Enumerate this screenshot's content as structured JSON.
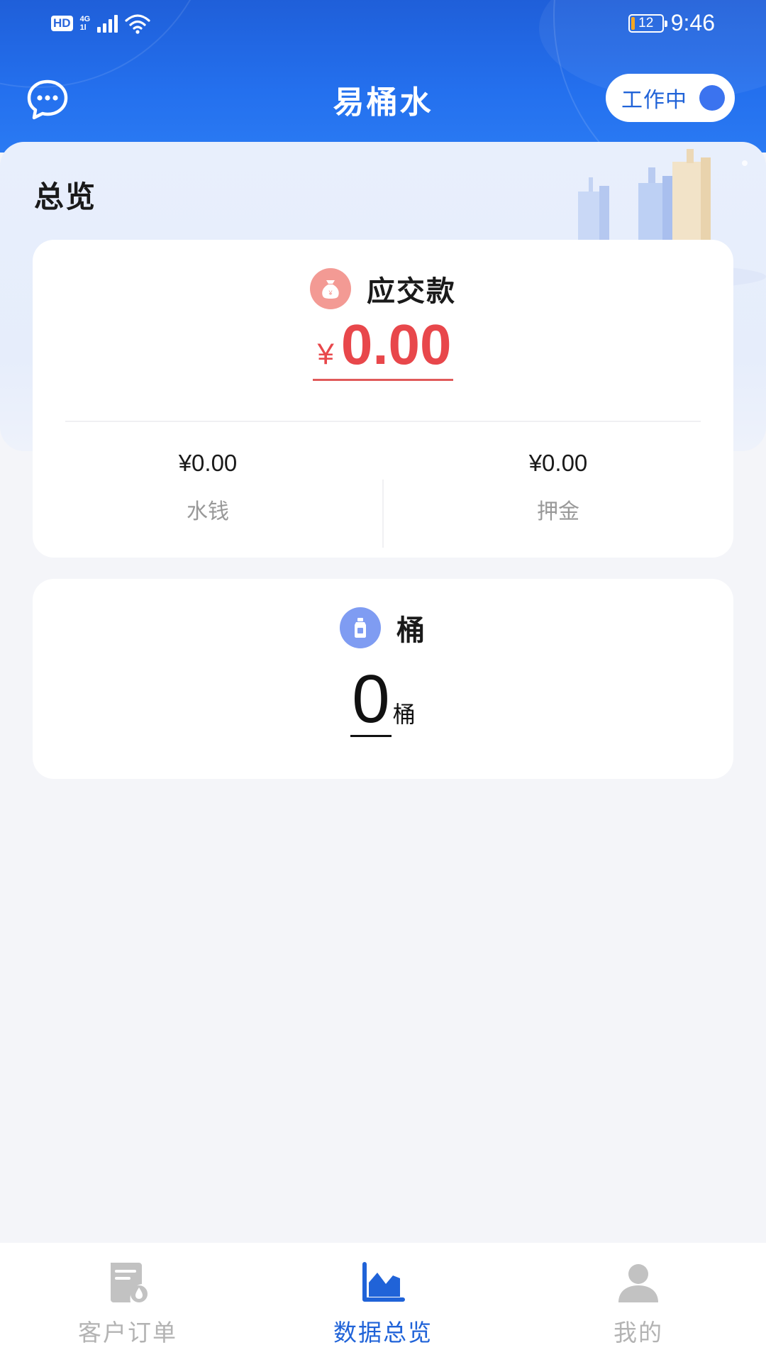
{
  "status_bar": {
    "hd": "HD",
    "network_top": "4G",
    "network_bottom": "1l",
    "battery_level": "12",
    "battery_fraction": 0.12,
    "time": "9:46"
  },
  "header": {
    "title": "易桶水",
    "work_status_label": "工作中"
  },
  "overview": {
    "title": "总览"
  },
  "payment_card": {
    "label": "应交款",
    "currency": "¥",
    "amount": "0.00",
    "water_money_value": "¥0.00",
    "water_money_label": "水钱",
    "deposit_value": "¥0.00",
    "deposit_label": "押金"
  },
  "bucket_card": {
    "label": "桶",
    "count": "0",
    "unit": "桶"
  },
  "tabs": [
    {
      "label": "客户订单",
      "icon": "order-icon",
      "active": false
    },
    {
      "label": "数据总览",
      "icon": "chart-icon",
      "active": true
    },
    {
      "label": "我的",
      "icon": "user-icon",
      "active": false
    }
  ],
  "colors": {
    "brand_blue": "#2063d8",
    "amount_red": "#e8474b",
    "inactive_gray": "#b3b3b3"
  }
}
